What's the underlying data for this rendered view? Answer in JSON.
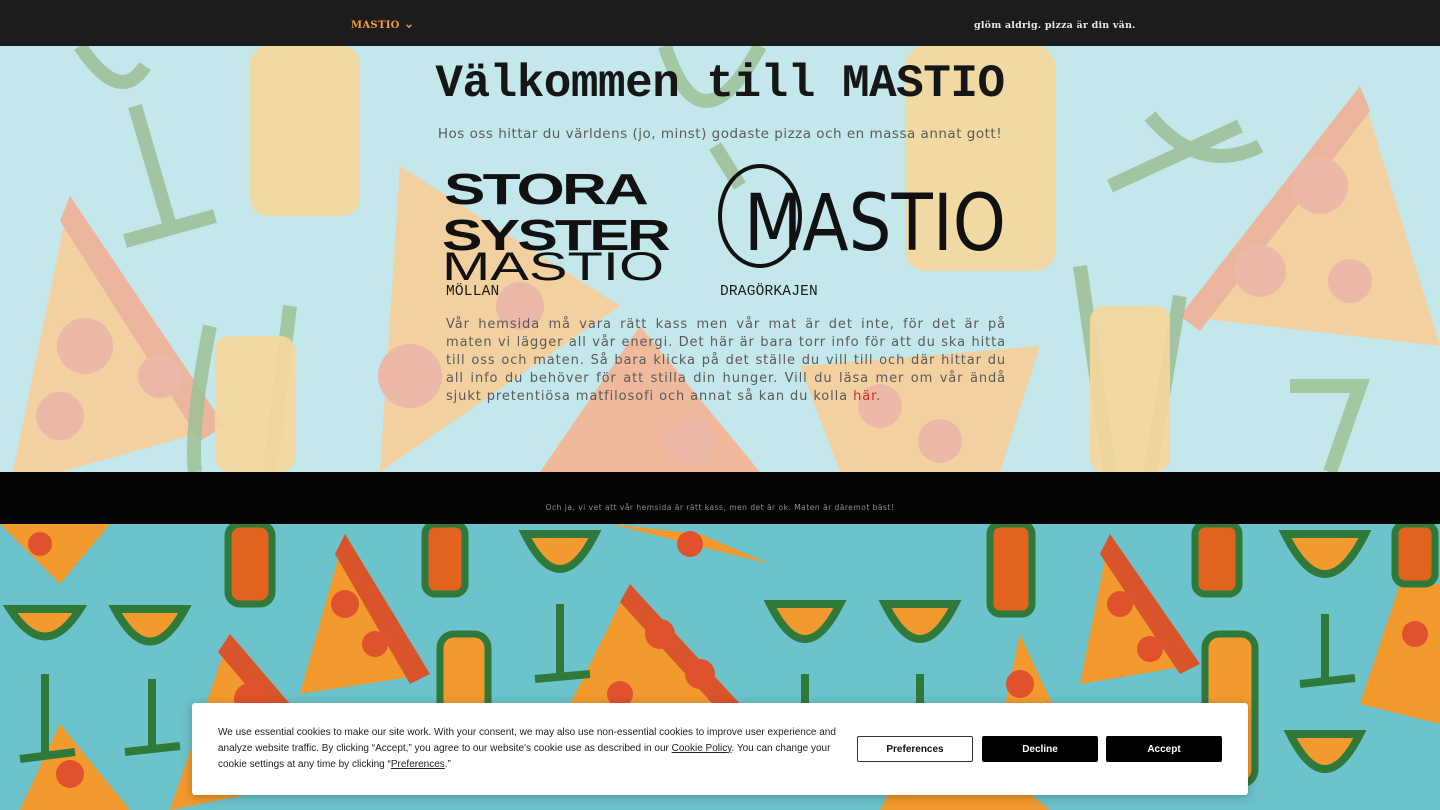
{
  "header": {
    "brand": "MASTIO",
    "tagline": "glöm aldrig. pizza är din vän."
  },
  "hero": {
    "title": "Välkommen till MASTIO",
    "intro": "Hos oss hittar du världens (jo, minst) godaste pizza och en massa annat gott!",
    "locations": [
      {
        "logo_text": [
          "STORA",
          "SYSTER",
          "MASTIO"
        ],
        "label": "MÖLLAN"
      },
      {
        "logo_text": "MASTIO",
        "label": "DRAGÖRKAJEN"
      }
    ],
    "body_text": "Vår hemsida må vara rätt kass men vår mat är det inte, för det är på maten vi lägger all vår energi. Det här är bara torr info för att du ska hitta till oss och maten. Så bara klicka på det ställe du vill till och där hittar du all info du behöver för att stilla din hunger. Vill du läsa mer om vår ändå sjukt pretentiösa matfilosofi och annat så kan du kolla ",
    "body_link": "här",
    "body_end": "."
  },
  "strip": {
    "text": "Och ja, vi vet att vår hemsida är rätt kass, men det är ok. Maten är däremot bäst!"
  },
  "cookie_banner": {
    "text_1": "We use essential cookies to make our site work. With your consent, we may also use non-essential cookies to improve user experience and analyze website traffic. By clicking “Accept,” you agree to our website's cookie use as described in our ",
    "link_policy": "Cookie Policy",
    "text_2": ". You can change your cookie settings at any time by clicking “",
    "link_prefs": "Preferences",
    "text_3": ".”",
    "buttons": {
      "preferences": "Preferences",
      "decline": "Decline",
      "accept": "Accept"
    }
  },
  "colors": {
    "topbar": "#1c1c1c",
    "brand_orange": "#f39a36",
    "hero_bg": "#c3e7ea",
    "pattern_bg": "#6cc3cb",
    "link_red": "#c8322a"
  }
}
